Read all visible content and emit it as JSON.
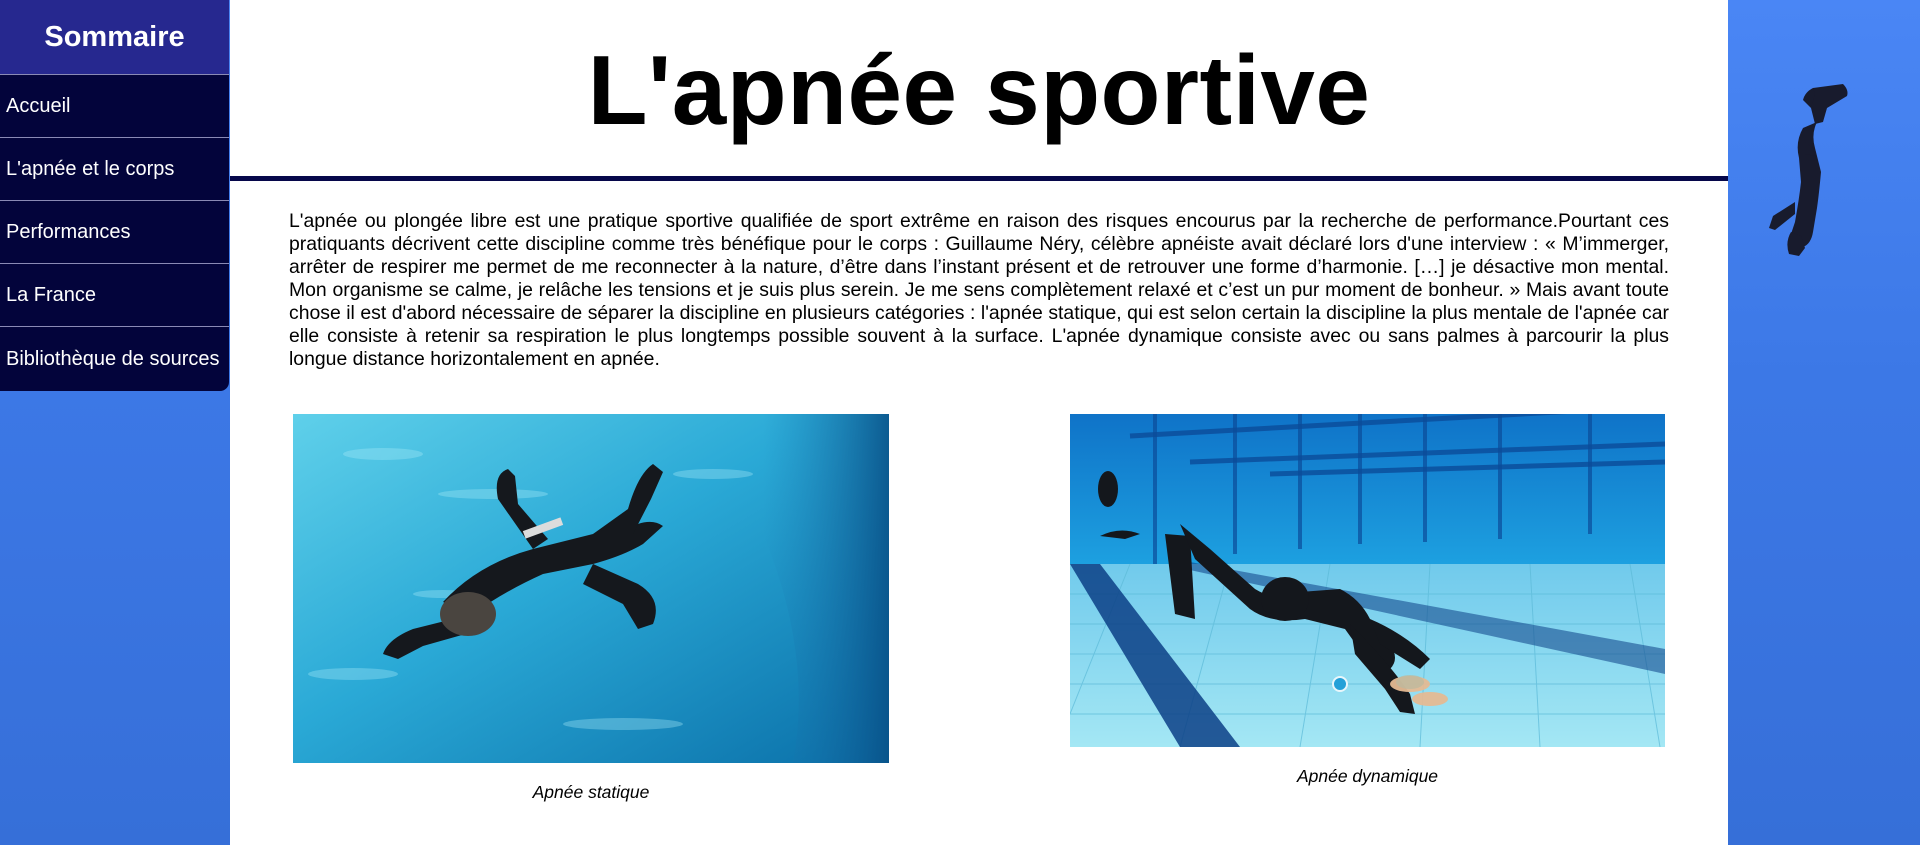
{
  "sidebar": {
    "title": "Sommaire",
    "items": [
      {
        "label": "Accueil"
      },
      {
        "label": "L'apnée et le corps"
      },
      {
        "label": "Performances"
      },
      {
        "label": "La France"
      },
      {
        "label": "Bibliothèque de sources"
      }
    ]
  },
  "main": {
    "title": "L'apnée sportive",
    "intro": "L'apnée ou plongée libre est une pratique sportive qualifiée de sport extrême en raison des risques encourus par la recherche de performance.Pourtant ces pratiquants décrivent cette discipline comme très bénéfique pour le corps : Guillaume Néry, célèbre apnéiste avait déclaré lors d'une interview : « M’immerger, arrêter de respirer me permet de me reconnecter à la nature, d’être dans l’instant présent et de retrouver une forme d’harmonie. […] je désactive mon mental. Mon organisme se calme, je relâche les tensions et je suis plus serein. Je me sens complètement relaxé et c’est un pur moment de bonheur. » Mais avant toute chose il est d'abord nécessaire de séparer la discipline en plusieurs catégories : l'apnée statique, qui est selon certain la discipline la plus mentale de l'apnée car elle consiste à retenir sa respiration le plus longtemps possible souvent à la surface. L'apnée dynamique consiste avec ou sans palmes à parcourir la plus longue distance horizontalement en apnée.",
    "figures": [
      {
        "caption": "Apnée statique"
      },
      {
        "caption": "Apnée dynamique"
      }
    ]
  },
  "colors": {
    "sidebar_bg": "#03043b",
    "sidebar_header_bg": "#26288f",
    "page_bg": "#4a86f5",
    "title_rule": "#06074a"
  },
  "icons": {
    "diver": "freediver-silhouette-icon"
  }
}
